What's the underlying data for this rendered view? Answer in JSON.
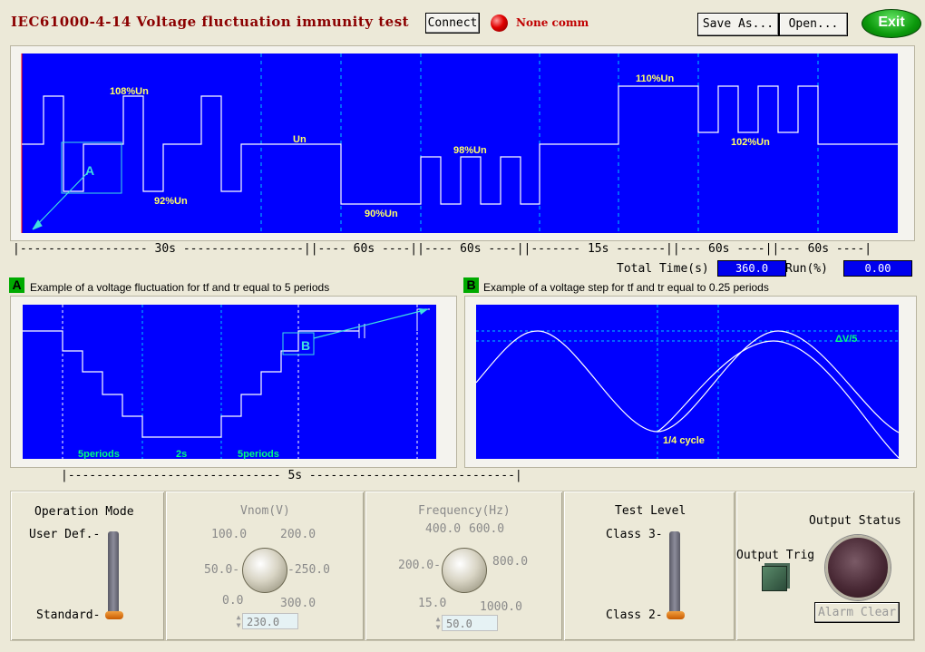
{
  "app": {
    "title": "IEC61000-4-14 Voltage fluctuation immunity test",
    "connect_label": "Connect",
    "connection_status": "None comm",
    "save_label": "Save As...",
    "open_label": "Open...",
    "exit_label": "Exit"
  },
  "main_chart": {
    "labels": [
      "108%Un",
      "92%Un",
      "Un",
      "90%Un",
      "98%Un",
      "110%Un",
      "102%Un"
    ],
    "marker": "A",
    "timeline": "|------------------ 30s -----------------||---- 60s ----||---- 60s ----||------- 15s -------||--- 60s ----||--- 60s ----|"
  },
  "totals": {
    "total_label": "Total Time(s)",
    "total_value": "360.0",
    "run_label": "Run(%)",
    "run_value": "0.00"
  },
  "chart_a": {
    "badge": "A",
    "caption": "Example of a voltage fluctuation for tf and tr equal to 5 periods",
    "labels": [
      "5periods",
      "2s",
      "5periods"
    ],
    "marker": "B",
    "timeline": "|------------------------------ 5s -----------------------------|"
  },
  "chart_b": {
    "badge": "B",
    "caption": "Example of a voltage step for tf and tr equal to 0.25 periods",
    "delta_label": "ΔV/5",
    "cycle_label": "1/4 cycle"
  },
  "controls": {
    "operation_mode": {
      "title": "Operation Mode",
      "top_label": "User Def.-",
      "bottom_label": "Standard-"
    },
    "vnom": {
      "title": "Vnom(V)",
      "scale": [
        "100.0",
        "200.0",
        "50.0-",
        "-250.0",
        "0.0",
        "300.0"
      ],
      "value": "230.0"
    },
    "frequency": {
      "title": "Frequency(Hz)",
      "scale": [
        "400.0",
        "600.0",
        "200.0-",
        "800.0",
        "15.0",
        "1000.0"
      ],
      "value": "50.0"
    },
    "test_level": {
      "title": "Test Level",
      "top_label": "Class 3-",
      "bottom_label": "Class 2-"
    },
    "output": {
      "trig_label": "Output Trig",
      "status_label": "Output Status",
      "alarm_label": "Alarm Clear"
    }
  },
  "colors": {
    "plot_bg": "#0000ff",
    "grid": "#00c8ff",
    "trace": "#ffffff",
    "label": "#ffff66",
    "title": "#8b0000"
  }
}
